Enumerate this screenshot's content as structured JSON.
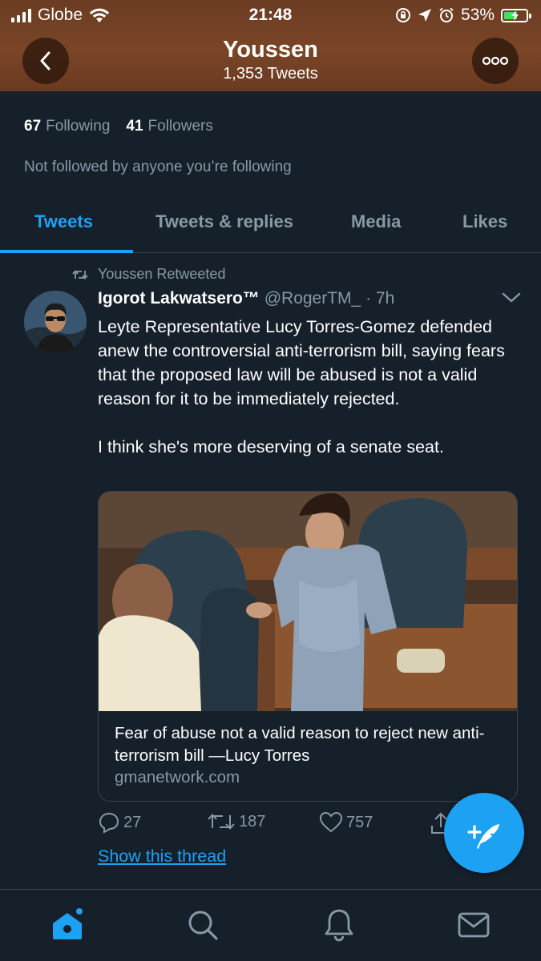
{
  "status_bar": {
    "carrier": "Globe",
    "time": "21:48",
    "battery_percent": "53%"
  },
  "header": {
    "title": "Youssen",
    "tweet_count": "1,353 Tweets"
  },
  "profile": {
    "following_count": "67",
    "following_label": "Following",
    "followers_count": "41",
    "followers_label": "Followers",
    "not_followed_text": "Not followed by anyone you’re following"
  },
  "tabs": [
    {
      "label": "Tweets",
      "active": true
    },
    {
      "label": "Tweets & replies",
      "active": false
    },
    {
      "label": "Media",
      "active": false
    },
    {
      "label": "Likes",
      "active": false
    }
  ],
  "tweet": {
    "retweeted_by": "Youssen Retweeted",
    "author_name": "Igorot Lakwatsero™",
    "author_handle": "@RogerTM_",
    "time": "· 7h",
    "text_p1": "Leyte Representative Lucy Torres-Gomez defended anew the controversial anti-terrorism bill, saying fears that the proposed law will be abused is not a valid reason for it to be immediately rejected.",
    "text_p2": "I think she's more deserving of a senate seat.",
    "card": {
      "title": "Fear of abuse not a valid reason to reject new anti-terrorism bill —Lucy Torres",
      "domain": "gmanetwork.com"
    },
    "replies": "27",
    "retweets": "187",
    "likes": "757",
    "show_thread": "Show this thread"
  },
  "colors": {
    "background": "#15202b",
    "accent": "#1da1f2",
    "secondary_text": "#8899a6",
    "divider": "#38444d",
    "header_banner": "#7a4527"
  },
  "icons": {
    "back": "chevron-left-icon",
    "more": "more-horizontal-icon",
    "retweet": "retweet-icon",
    "reply": "reply-icon",
    "like": "heart-icon",
    "share": "share-icon",
    "compose": "compose-tweet-icon",
    "nav_home": "home-icon",
    "nav_search": "search-icon",
    "nav_notifications": "bell-icon",
    "nav_messages": "mail-icon"
  }
}
